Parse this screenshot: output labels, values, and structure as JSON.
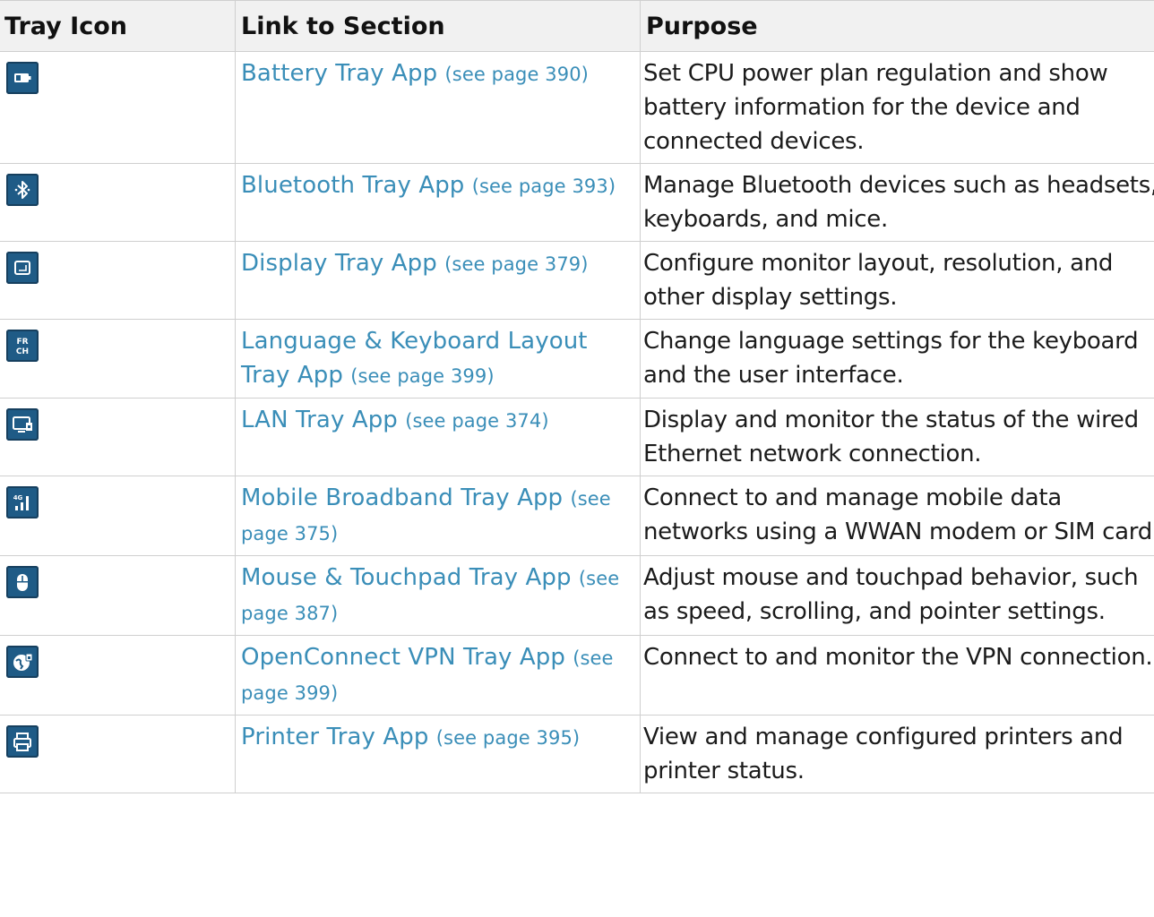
{
  "table": {
    "headers": [
      "Tray Icon",
      "Link to Section",
      "Purpose"
    ],
    "rows": [
      {
        "icon": "battery-icon",
        "link": "Battery Tray App",
        "page": "(see page 390)",
        "purpose": "Set CPU power plan regulation and show battery information for the device and connected devices."
      },
      {
        "icon": "bluetooth-icon",
        "link": "Bluetooth Tray App",
        "page": "(see page 393)",
        "purpose": "Manage Bluetooth devices such as headsets, keyboards, and mice."
      },
      {
        "icon": "display-icon",
        "link": "Display Tray App",
        "page": "(see page 379)",
        "purpose": "Configure monitor layout, resolution, and other display settings."
      },
      {
        "icon": "language-keyboard-icon",
        "icon_text": [
          "FR",
          "CH"
        ],
        "link": "Language & Keyboard Layout Tray App",
        "page": "(see page 399)",
        "purpose": "Change language settings for the keyboard and the user interface."
      },
      {
        "icon": "lan-icon",
        "link": "LAN Tray App",
        "page": "(see page 374)",
        "purpose": "Display and monitor the status of the wired Ethernet network connection."
      },
      {
        "icon": "mobile-broadband-icon",
        "icon_text": [
          "4G"
        ],
        "link": "Mobile Broadband Tray App",
        "page": "(see page 375)",
        "purpose": "Connect to and manage mobile data networks using a WWAN modem or SIM card."
      },
      {
        "icon": "mouse-icon",
        "link": "Mouse & Touchpad Tray App",
        "page": "(see page 387)",
        "purpose": "Adjust mouse and touchpad behavior, such as speed, scrolling, and pointer settings."
      },
      {
        "icon": "vpn-globe-icon",
        "link": "OpenConnect VPN Tray App",
        "page": "(see page 399)",
        "purpose": "Connect to and monitor the VPN connection."
      },
      {
        "icon": "printer-icon",
        "link": "Printer Tray App",
        "page": "(see page 395)",
        "purpose": "View and manage configured printers and printer status."
      }
    ]
  },
  "colors": {
    "link": "#3a8eb8",
    "icon_bg": "#1f5b86",
    "header_bg": "#f1f1f1",
    "border": "#cfcfcf"
  }
}
